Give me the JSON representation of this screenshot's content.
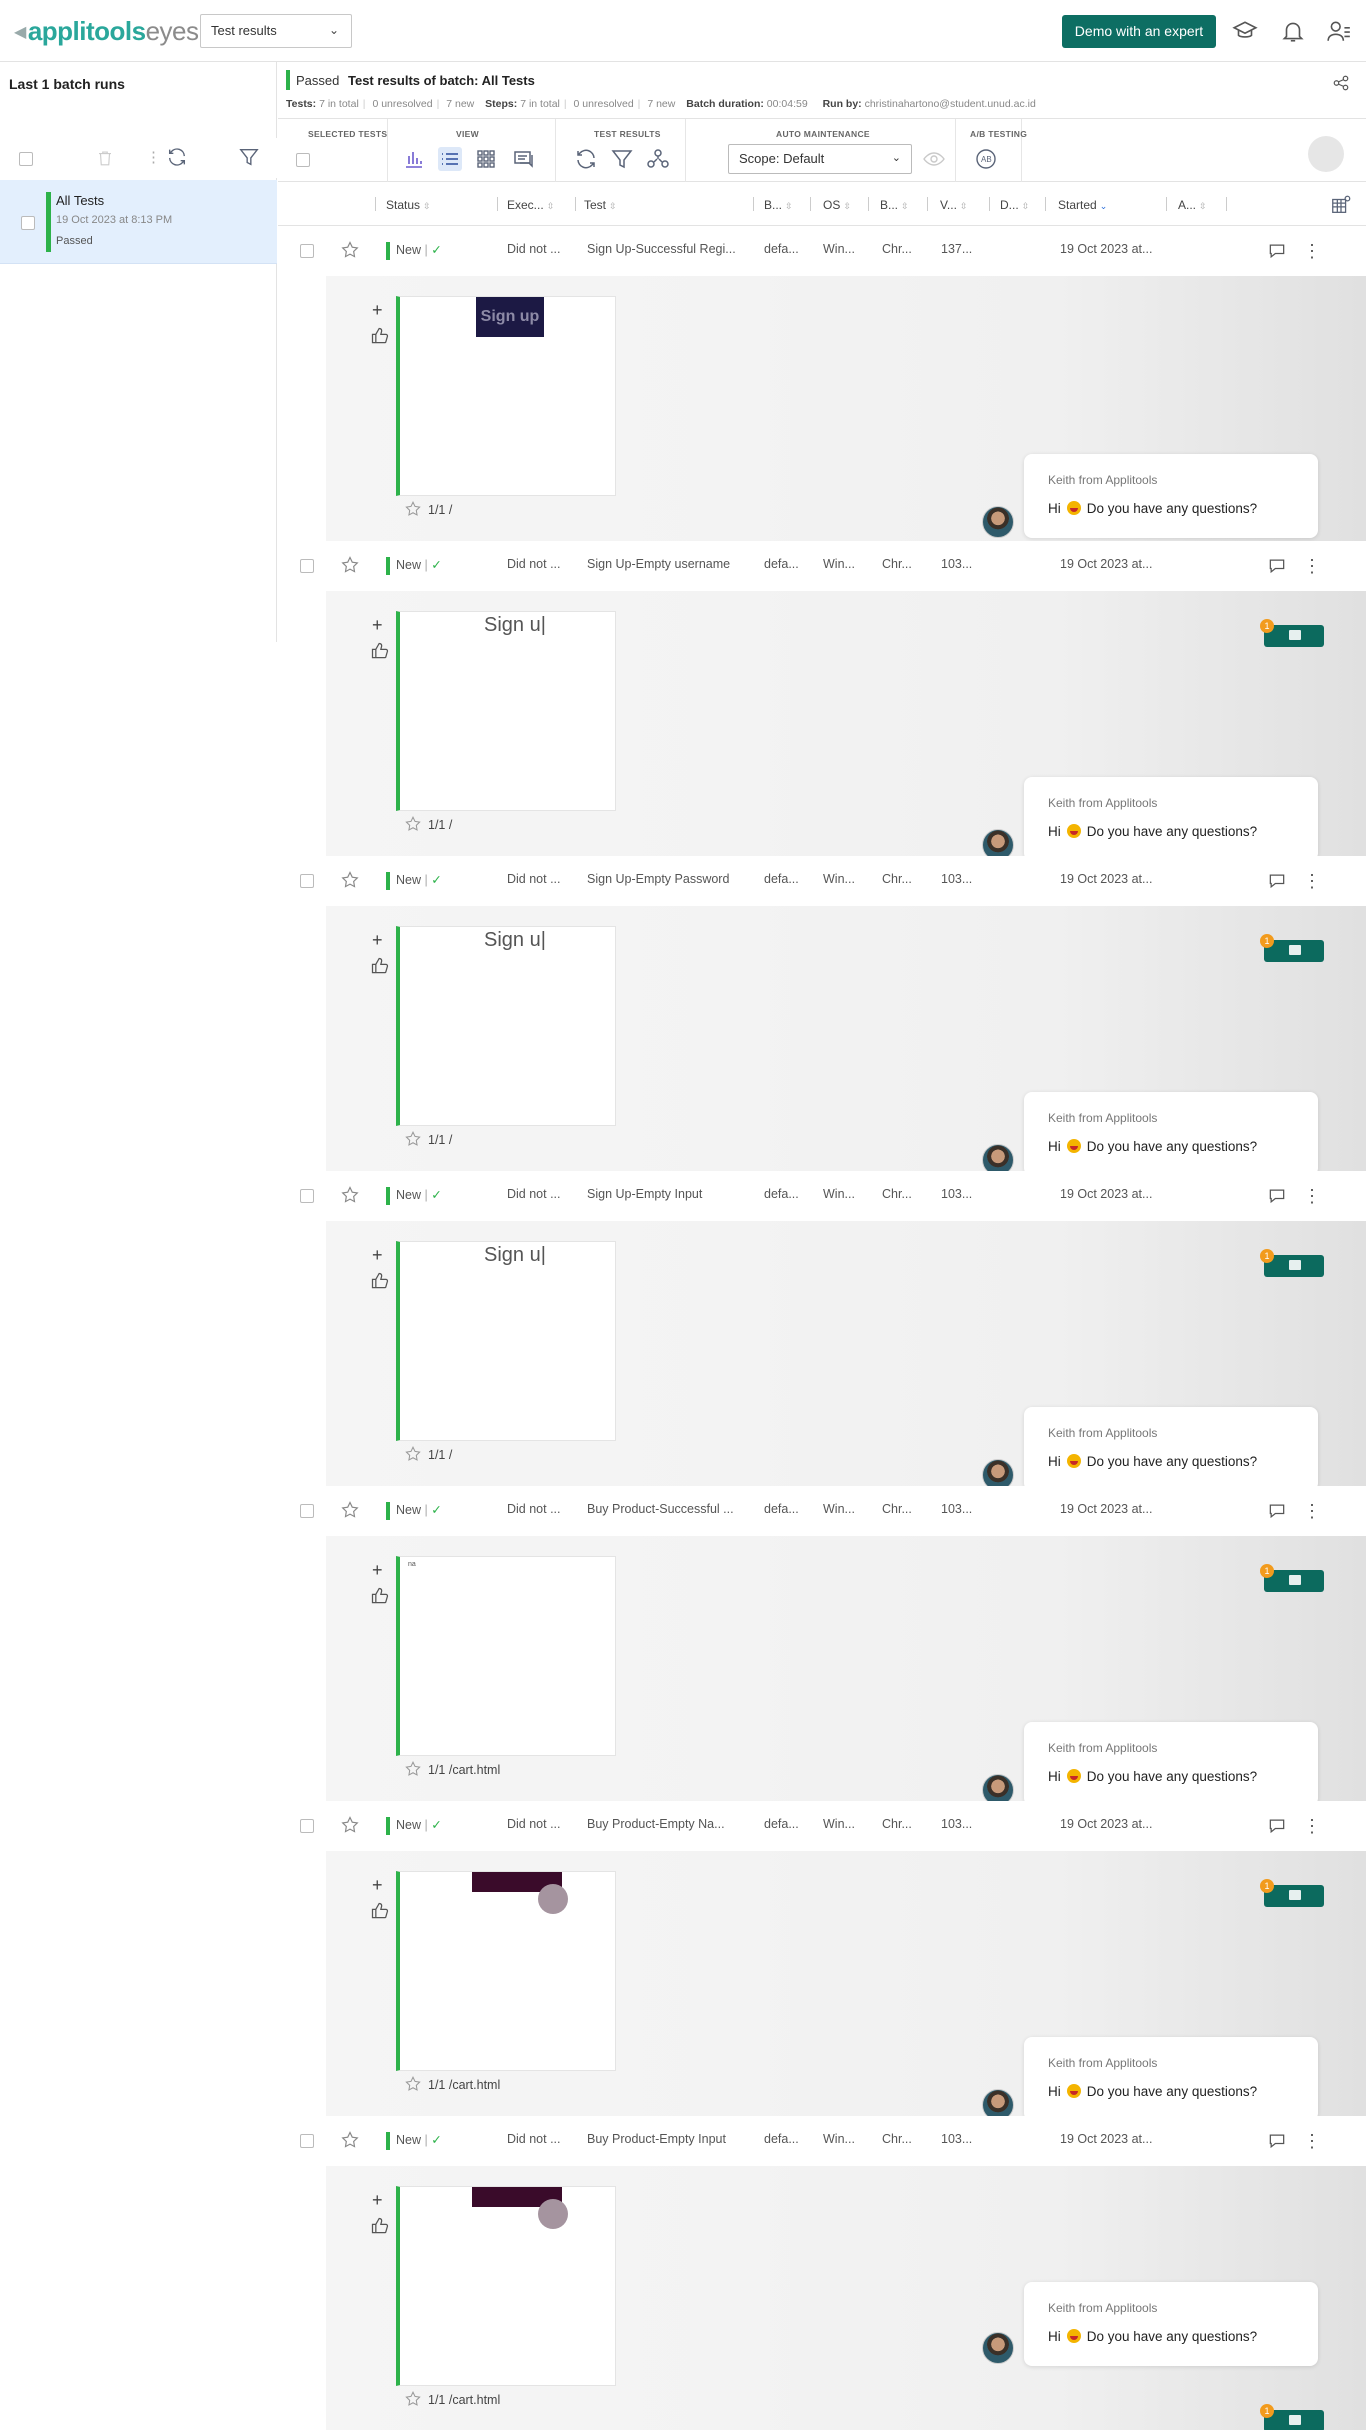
{
  "topbar": {
    "logo_brand": "applitools",
    "logo_product": "eyes",
    "view_select": "Test results",
    "demo_button": "Demo with an expert"
  },
  "sidebar": {
    "title": "Last 1 batch runs",
    "item": {
      "name": "All Tests",
      "date": "19 Oct 2023 at 8:13 PM",
      "status": "Passed"
    }
  },
  "batch": {
    "status": "Passed",
    "title": "Test results of batch:  All Tests",
    "tests_label": "Tests:",
    "tests_total": "7 in total",
    "tests_unresolved": "0 unresolved",
    "tests_new": "7 new",
    "steps_label": "Steps:",
    "steps_total": "7 in total",
    "steps_unresolved": "0 unresolved",
    "steps_new": "7 new",
    "duration_label": "Batch duration:",
    "duration": "00:04:59",
    "runby_label": "Run by:",
    "runby": "christinahartono@student.unud.ac.id"
  },
  "toolbar": {
    "selected_tests": "SELECTED TESTS",
    "view": "VIEW",
    "test_results": "TEST RESULTS",
    "auto_maintenance": "AUTO MAINTENANCE",
    "ab_testing": "A/B TESTING",
    "scope": "Scope: Default"
  },
  "columns": [
    "Status",
    "Exec...",
    "Test",
    "B...",
    "OS",
    "B...",
    "V...",
    "D...",
    "Started",
    "A..."
  ],
  "rows": [
    {
      "status": "New",
      "exec": "Did not ...",
      "test": "Sign Up-Successful Regi...",
      "b1": "defa...",
      "os": "Win...",
      "b2": "Chr...",
      "v": "137...",
      "started": "19 Oct 2023 at...",
      "meta": "1/1 /",
      "snap": "signup-dark"
    },
    {
      "status": "New",
      "exec": "Did not ...",
      "test": "Sign Up-Empty username",
      "b1": "defa...",
      "os": "Win...",
      "b2": "Chr...",
      "v": "103...",
      "started": "19 Oct 2023 at...",
      "meta": "1/1 /",
      "snap": "signup-text"
    },
    {
      "status": "New",
      "exec": "Did not ...",
      "test": "Sign Up-Empty Password",
      "b1": "defa...",
      "os": "Win...",
      "b2": "Chr...",
      "v": "103...",
      "started": "19 Oct 2023 at...",
      "meta": "1/1 /",
      "snap": "signup-text"
    },
    {
      "status": "New",
      "exec": "Did not ...",
      "test": "Sign Up-Empty Input",
      "b1": "defa...",
      "os": "Win...",
      "b2": "Chr...",
      "v": "103...",
      "started": "19 Oct 2023 at...",
      "meta": "1/1 /",
      "snap": "signup-text"
    },
    {
      "status": "New",
      "exec": "Did not ...",
      "test": "Buy Product-Successful ...",
      "b1": "defa...",
      "os": "Win...",
      "b2": "Chr...",
      "v": "103...",
      "started": "19 Oct 2023 at...",
      "meta": "1/1 /cart.html",
      "snap": "blank"
    },
    {
      "status": "New",
      "exec": "Did not ...",
      "test": "Buy Product-Empty Na...",
      "b1": "defa...",
      "os": "Win...",
      "b2": "Chr...",
      "v": "103...",
      "started": "19 Oct 2023 at...",
      "meta": "1/1 /cart.html",
      "snap": "maroon"
    },
    {
      "status": "New",
      "exec": "Did not ...",
      "test": "Buy Product-Empty Input",
      "b1": "defa...",
      "os": "Win...",
      "b2": "Chr...",
      "v": "103...",
      "started": "19 Oct 2023 at...",
      "meta": "1/1 /cart.html",
      "snap": "maroon"
    }
  ],
  "snapshot_texts": {
    "signup": "Sign up",
    "signup_clipped": "Sign u|",
    "cart_small": "na"
  },
  "chat": {
    "from": "Keith from Applitools",
    "greeting": "Hi",
    "question": "Do you have any questions?",
    "badge": "1"
  },
  "colors": {
    "accent": "#0d6e63",
    "passed": "#2db24a",
    "brand": "#2aa79b"
  }
}
